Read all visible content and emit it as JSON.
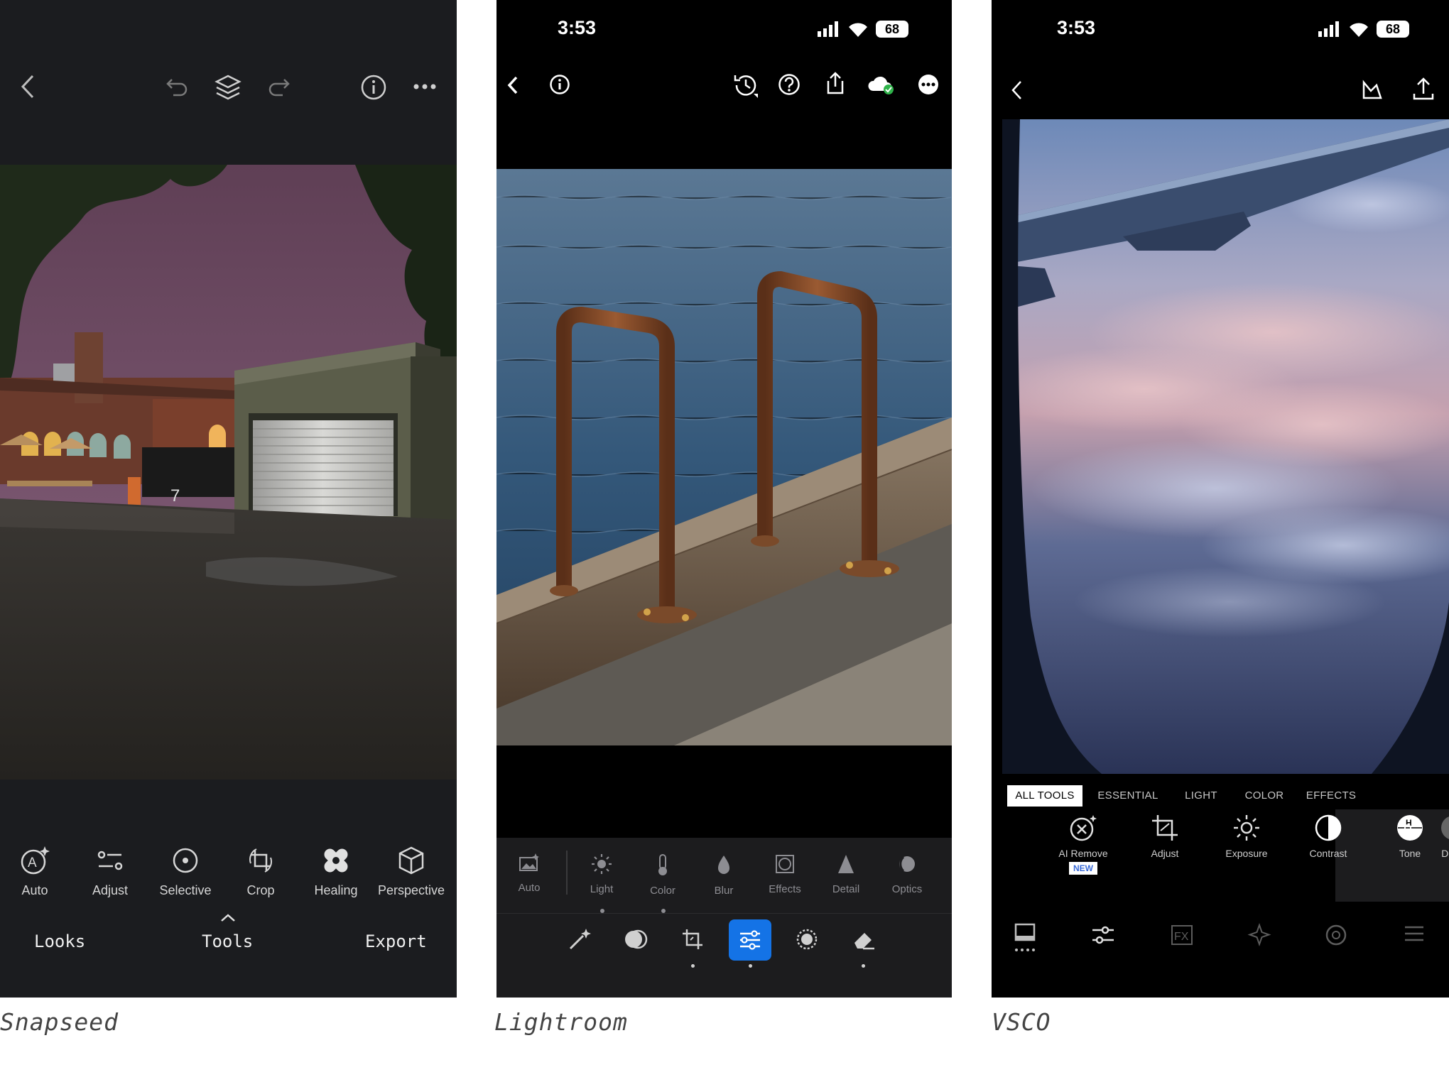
{
  "snapseed": {
    "caption": "Snapseed",
    "tools": [
      {
        "label": "Auto",
        "icon": "auto-icon"
      },
      {
        "label": "Adjust",
        "icon": "adjust-icon"
      },
      {
        "label": "Selective",
        "icon": "selective-icon"
      },
      {
        "label": "Crop",
        "icon": "crop-icon"
      },
      {
        "label": "Healing",
        "icon": "healing-icon"
      },
      {
        "label": "Perspective",
        "icon": "perspective-icon"
      }
    ],
    "nav": {
      "looks": "Looks",
      "tools": "Tools",
      "export": "Export"
    },
    "photo": {
      "tower_number": "7"
    }
  },
  "lightroom": {
    "caption": "Lightroom",
    "status_time": "3:53",
    "battery": "68",
    "tools": [
      {
        "label": "Auto",
        "icon": "auto-icon"
      },
      {
        "label": "Light",
        "icon": "light-icon"
      },
      {
        "label": "Color",
        "icon": "color-icon"
      },
      {
        "label": "Blur",
        "icon": "blur-icon"
      },
      {
        "label": "Effects",
        "icon": "effects-icon"
      },
      {
        "label": "Detail",
        "icon": "detail-icon"
      },
      {
        "label": "Optics",
        "icon": "optics-icon"
      }
    ],
    "accent": "#1473e6"
  },
  "vsco": {
    "caption": "VSCO",
    "status_time": "3:53",
    "battery": "68",
    "tabs": [
      "ALL TOOLS",
      "ESSENTIAL",
      "LIGHT",
      "COLOR",
      "EFFECTS"
    ],
    "tools": [
      {
        "label": "AI Remove",
        "badge": "NEW",
        "icon": "ai-remove-icon"
      },
      {
        "label": "Adjust",
        "icon": "adjust-icon"
      },
      {
        "label": "Exposure",
        "icon": "exposure-icon"
      },
      {
        "label": "Contrast",
        "icon": "contrast-icon"
      },
      {
        "label": "Tone",
        "icon": "tone-icon"
      },
      {
        "label": "Dodg",
        "icon": "dodge-icon"
      }
    ]
  }
}
